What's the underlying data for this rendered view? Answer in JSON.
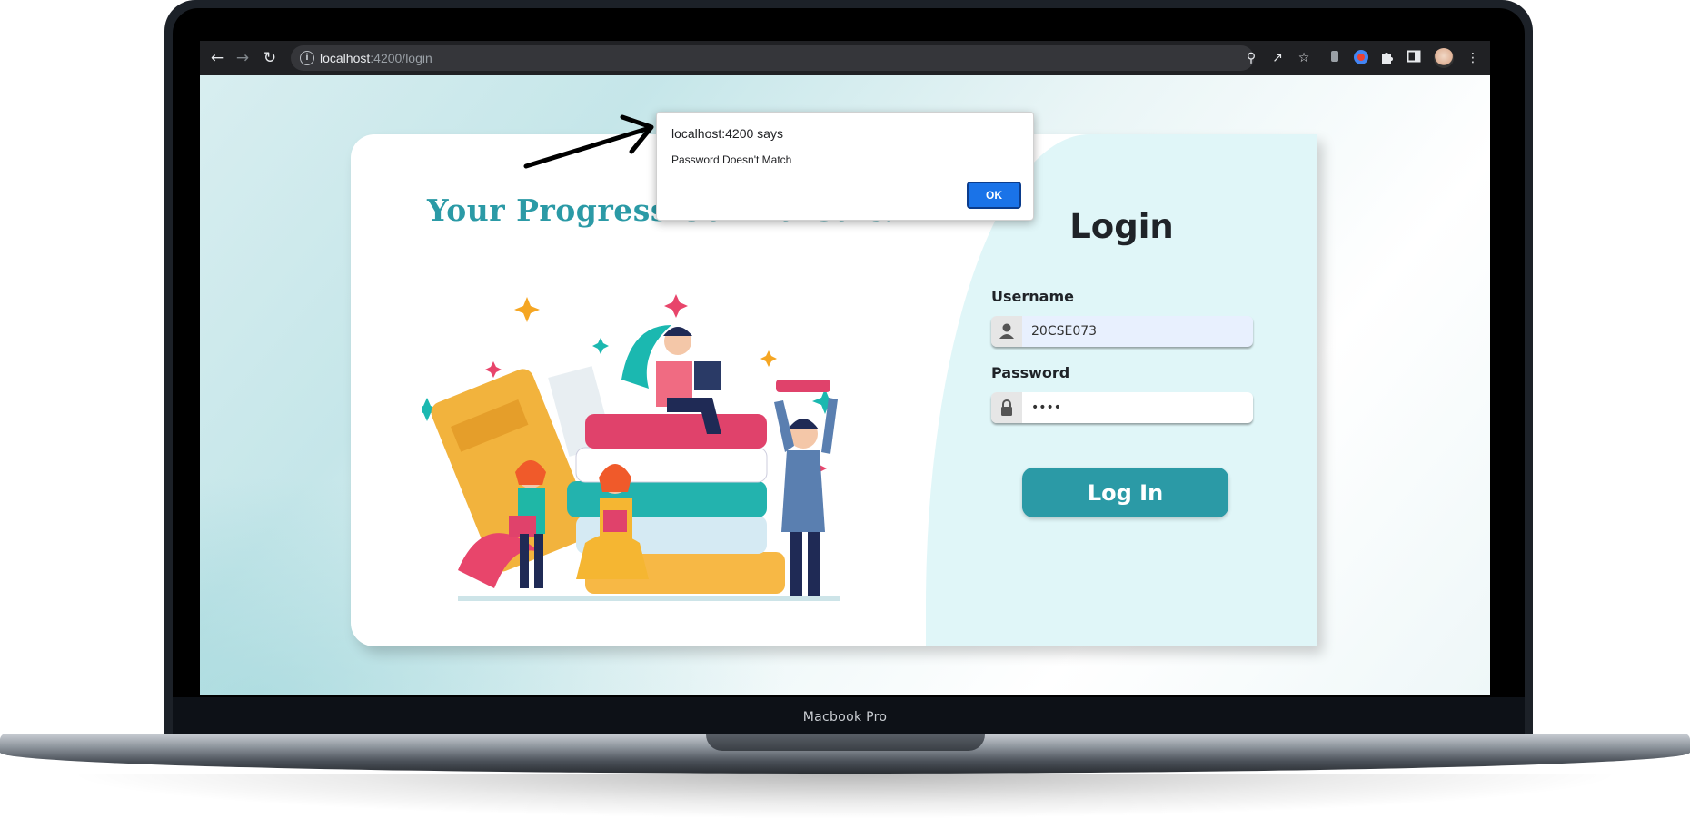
{
  "device": {
    "label": "Macbook Pro"
  },
  "browser": {
    "url_host": "localhost",
    "url_path": ":4200/login",
    "back_icon": "arrow-left-icon",
    "forward_icon": "arrow-right-icon",
    "reload_icon": "reload-icon",
    "toolbar_icons": [
      "key-icon",
      "share-icon",
      "star-icon",
      "extension-icon",
      "profile-icon",
      "puzzle-icon",
      "side-panel-icon",
      "avatar",
      "kebab-menu-icon"
    ]
  },
  "page": {
    "tagline": "Your Progress Our Pursuit!",
    "login": {
      "title": "Login",
      "username_label": "Username",
      "username_value": "20CSE073",
      "password_label": "Password",
      "password_value": "••••",
      "button_label": "Log In"
    },
    "colors": {
      "accent": "#2b9aa6",
      "panel": "#e0f6f8"
    }
  },
  "alert": {
    "title": "localhost:4200 says",
    "message": "Password Doesn't Match",
    "ok_label": "OK"
  }
}
